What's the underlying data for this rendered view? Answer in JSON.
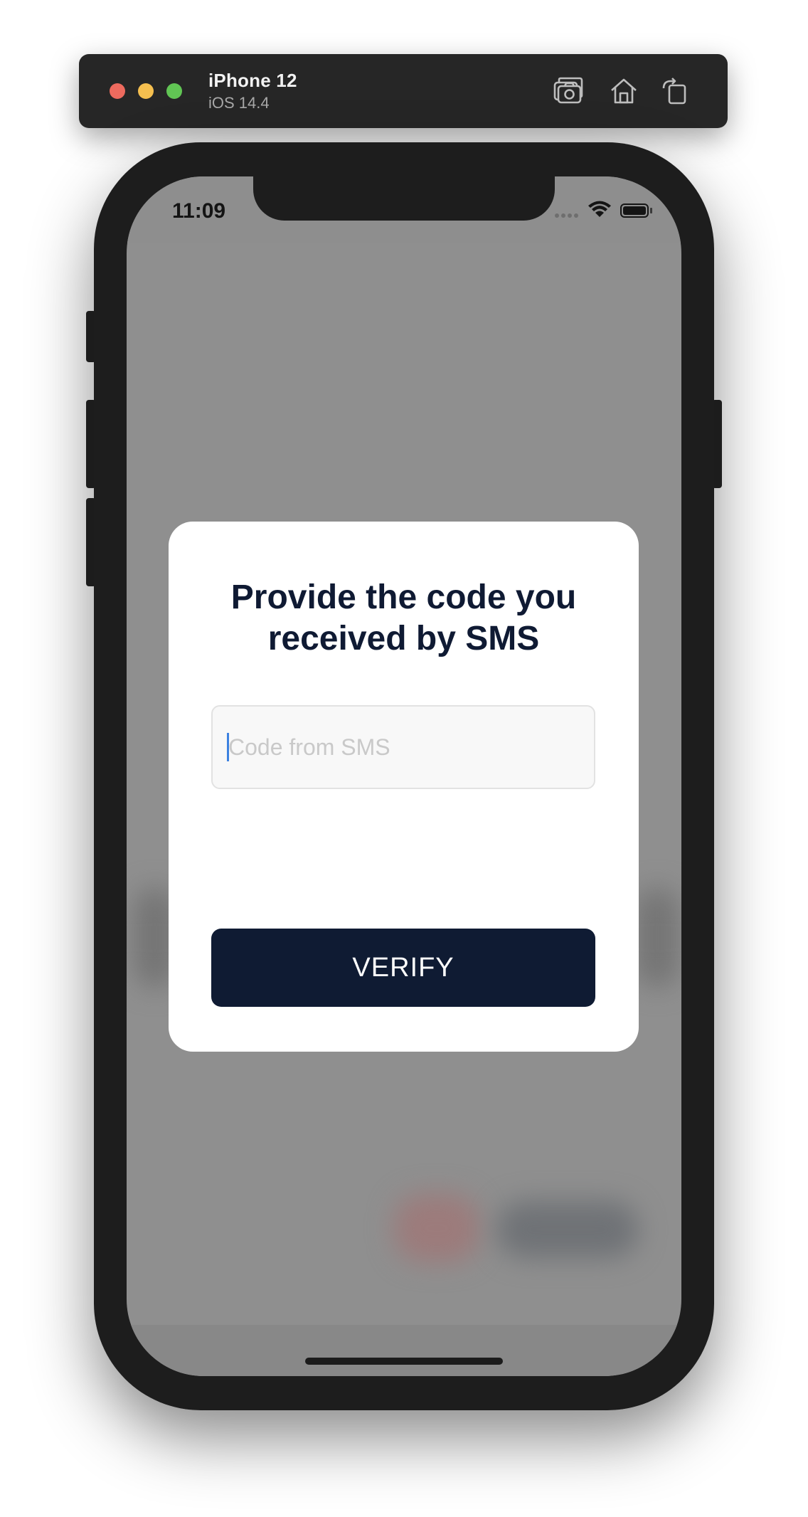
{
  "simulator": {
    "device_name": "iPhone 12",
    "os_version": "iOS 14.4",
    "toolbar_icons": [
      "screenshot-icon",
      "home-icon",
      "rotate-icon"
    ],
    "window_controls": [
      "close-button",
      "minimize-button",
      "zoom-button"
    ]
  },
  "status_bar": {
    "time": "11:09",
    "icons": [
      "signal-icon",
      "wifi-icon",
      "battery-icon"
    ]
  },
  "dialog": {
    "title": "Provide the code you\nreceived by SMS",
    "input": {
      "placeholder": "Code from SMS",
      "value": ""
    },
    "verify_label": "VERIFY"
  },
  "colors": {
    "primary": "#0f1b33",
    "backdrop": "#8f8f8f",
    "caret": "#3d82e0"
  }
}
